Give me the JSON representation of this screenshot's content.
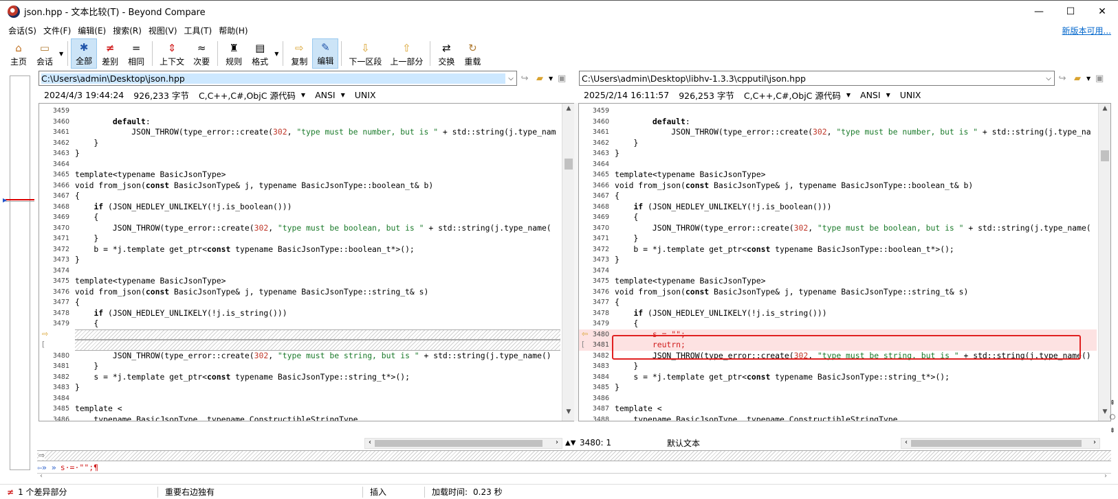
{
  "window": {
    "title": "json.hpp - 文本比较(T) - Beyond Compare",
    "minimize": "—",
    "maximize": "☐",
    "close": "✕"
  },
  "menu": {
    "items": [
      "会话(S)",
      "文件(F)",
      "编辑(E)",
      "搜索(R)",
      "视图(V)",
      "工具(T)",
      "帮助(H)"
    ],
    "new_version": "新版本可用..."
  },
  "toolbar": {
    "home": "主页",
    "session": "会话",
    "all": "全部",
    "diffs": "差别",
    "same": "相同",
    "context": "上下文",
    "minor": "次要",
    "rules": "规则",
    "format": "格式",
    "copy": "复制",
    "edit": "编辑",
    "next_section": "下一区段",
    "prev_section": "上一部分",
    "swap": "交换",
    "reload": "重载",
    "icons": {
      "home": "⌂",
      "session": "▭",
      "all": "✱",
      "diffs": "≠",
      "same": "=",
      "context": "⇕",
      "minor": "≈",
      "rules": "♜",
      "format": "▤",
      "copy": "⇨",
      "edit": "✎",
      "next_section": "⇩",
      "prev_section": "⇧",
      "swap": "⇄",
      "reload": "↻"
    }
  },
  "left": {
    "path": "C:\\Users\\admin\\Desktop\\json.hpp",
    "datetime": "2024/4/3 19:44:24",
    "size": "926,233 字节",
    "format": "C,C++,C#,ObjC 源代码",
    "encoding": "ANSI",
    "line_ending": "UNIX",
    "lines": [
      {
        "n": "3459",
        "c": ""
      },
      {
        "n": "3460",
        "c": "        default:"
      },
      {
        "n": "3461",
        "c": "            JSON_THROW(type_error::create(302, \"type must be number, but is \" + std::string(j.type_nam"
      },
      {
        "n": "3462",
        "c": "    }"
      },
      {
        "n": "3463",
        "c": "}"
      },
      {
        "n": "3464",
        "c": ""
      },
      {
        "n": "3465",
        "c": "template<typename BasicJsonType>"
      },
      {
        "n": "3466",
        "c": "void from_json(const BasicJsonType& j, typename BasicJsonType::boolean_t& b)"
      },
      {
        "n": "3467",
        "c": "{"
      },
      {
        "n": "3468",
        "c": "    if (JSON_HEDLEY_UNLIKELY(!j.is_boolean()))"
      },
      {
        "n": "3469",
        "c": "    {"
      },
      {
        "n": "3470",
        "c": "        JSON_THROW(type_error::create(302, \"type must be boolean, but is \" + std::string(j.type_name("
      },
      {
        "n": "3471",
        "c": "    }"
      },
      {
        "n": "3472",
        "c": "    b = *j.template get_ptr<const typename BasicJsonType::boolean_t*>();"
      },
      {
        "n": "3473",
        "c": "}"
      },
      {
        "n": "3474",
        "c": ""
      },
      {
        "n": "3475",
        "c": "template<typename BasicJsonType>"
      },
      {
        "n": "3476",
        "c": "void from_json(const BasicJsonType& j, typename BasicJsonType::string_t& s)"
      },
      {
        "n": "3477",
        "c": "{"
      },
      {
        "n": "3478",
        "c": "    if (JSON_HEDLEY_UNLIKELY(!j.is_string()))"
      },
      {
        "n": "3479",
        "c": "    {"
      },
      {
        "n": "",
        "c": ""
      },
      {
        "n": "",
        "c": ""
      },
      {
        "n": "3480",
        "c": "        JSON_THROW(type_error::create(302, \"type must be string, but is \" + std::string(j.type_name()"
      },
      {
        "n": "3481",
        "c": "    }"
      },
      {
        "n": "3482",
        "c": "    s = *j.template get_ptr<const typename BasicJsonType::string_t*>();"
      },
      {
        "n": "3483",
        "c": "}"
      },
      {
        "n": "3484",
        "c": ""
      },
      {
        "n": "3485",
        "c": "template <"
      },
      {
        "n": "3486",
        "c": "    typename BasicJsonType, typename ConstructibleStringType,"
      }
    ]
  },
  "right": {
    "path": "C:\\Users\\admin\\Desktop\\libhv-1.3.3\\cpputil\\json.hpp",
    "datetime": "2025/2/14 16:11:57",
    "size": "926,253 字节",
    "format": "C,C++,C#,ObjC 源代码",
    "encoding": "ANSI",
    "line_ending": "UNIX",
    "lines": [
      {
        "n": "3459",
        "c": ""
      },
      {
        "n": "3460",
        "c": "        default:"
      },
      {
        "n": "3461",
        "c": "            JSON_THROW(type_error::create(302, \"type must be number, but is \" + std::string(j.type_na"
      },
      {
        "n": "3462",
        "c": "    }"
      },
      {
        "n": "3463",
        "c": "}"
      },
      {
        "n": "3464",
        "c": ""
      },
      {
        "n": "3465",
        "c": "template<typename BasicJsonType>"
      },
      {
        "n": "3466",
        "c": "void from_json(const BasicJsonType& j, typename BasicJsonType::boolean_t& b)"
      },
      {
        "n": "3467",
        "c": "{"
      },
      {
        "n": "3468",
        "c": "    if (JSON_HEDLEY_UNLIKELY(!j.is_boolean()))"
      },
      {
        "n": "3469",
        "c": "    {"
      },
      {
        "n": "3470",
        "c": "        JSON_THROW(type_error::create(302, \"type must be boolean, but is \" + std::string(j.type_name("
      },
      {
        "n": "3471",
        "c": "    }"
      },
      {
        "n": "3472",
        "c": "    b = *j.template get_ptr<const typename BasicJsonType::boolean_t*>();"
      },
      {
        "n": "3473",
        "c": "}"
      },
      {
        "n": "3474",
        "c": ""
      },
      {
        "n": "3475",
        "c": "template<typename BasicJsonType>"
      },
      {
        "n": "3476",
        "c": "void from_json(const BasicJsonType& j, typename BasicJsonType::string_t& s)"
      },
      {
        "n": "3477",
        "c": "{"
      },
      {
        "n": "3478",
        "c": "    if (JSON_HEDLEY_UNLIKELY(!j.is_string()))"
      },
      {
        "n": "3479",
        "c": "    {"
      },
      {
        "n": "3480",
        "c": "        s = \"\";"
      },
      {
        "n": "3481",
        "c": "        reutrn;"
      },
      {
        "n": "3482",
        "c": "        JSON_THROW(type_error::create(302, \"type must be string, but is \" + std::string(j.type_name()"
      },
      {
        "n": "3483",
        "c": "    }"
      },
      {
        "n": "3484",
        "c": "    s = *j.template get_ptr<const typename BasicJsonType::string_t*>();"
      },
      {
        "n": "3485",
        "c": "}"
      },
      {
        "n": "3486",
        "c": ""
      },
      {
        "n": "3487",
        "c": "template <"
      },
      {
        "n": "3488",
        "c": "    typename BasicJsonType, typename ConstructibleStringType,"
      }
    ]
  },
  "panes_footer": {
    "cursor_pos": "3480: 1",
    "text_mode": "默认文本"
  },
  "compare_line": {
    "text": "s·=·\"\";¶",
    "markers": "⇦»  »"
  },
  "statusbar": {
    "diff_count": "1 个差异部分",
    "right_unique": "重要右边独有",
    "insert_mode": "插入",
    "load_time_label": "加载时间:",
    "load_time_value": "0.23 秒"
  },
  "colors": {
    "diff_bg": "#fde2e2",
    "diff_text": "#d01c1c",
    "highlight_box": "#e02020",
    "string_literal": "#1a7a2a",
    "number_literal": "#c0392b",
    "link": "#0066cc"
  }
}
